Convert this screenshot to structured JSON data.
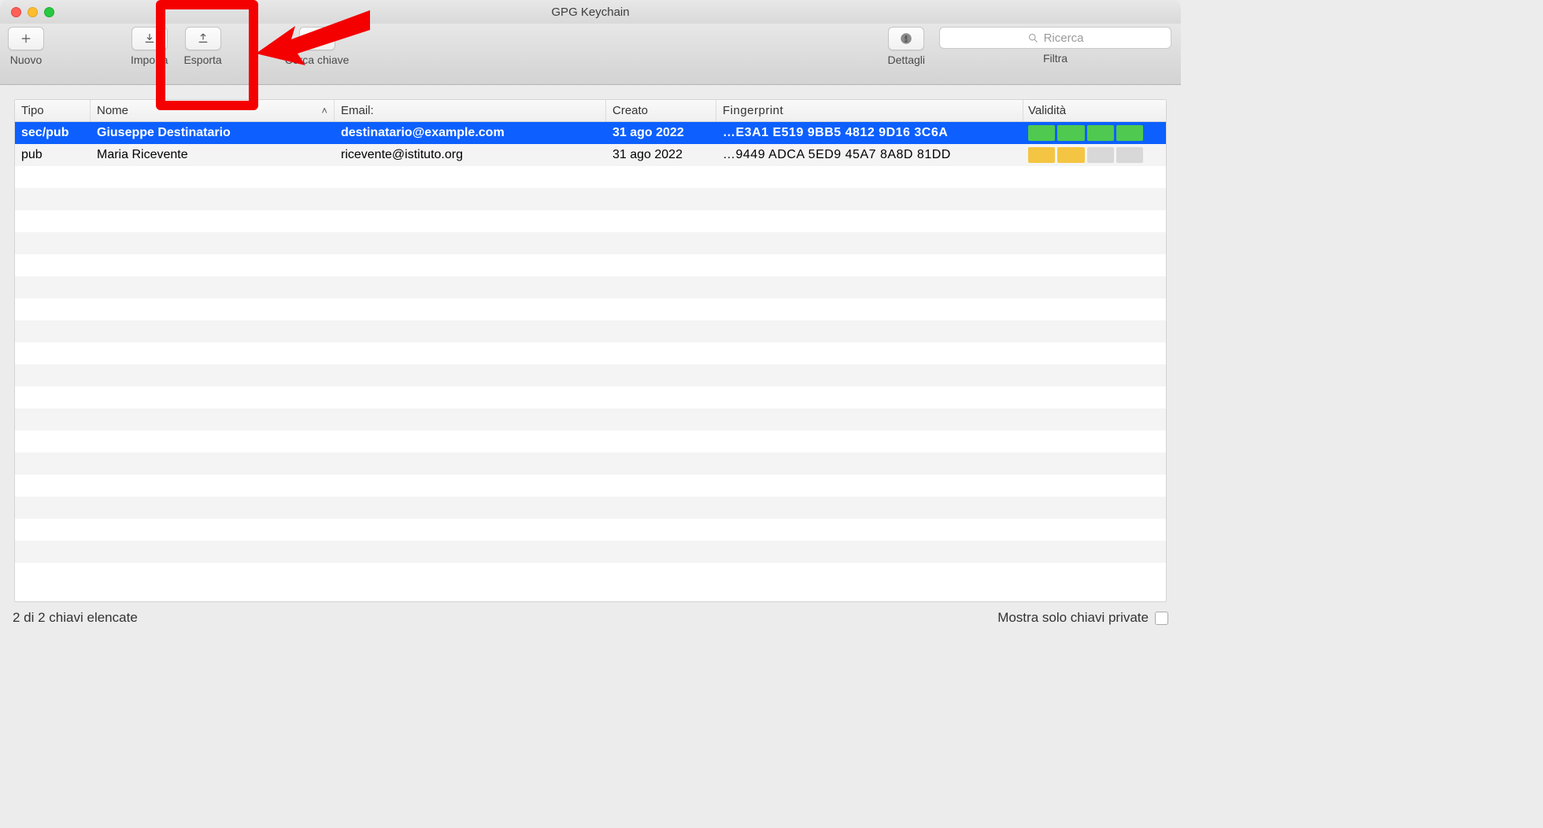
{
  "window": {
    "title": "GPG Keychain"
  },
  "toolbar": {
    "nuovo": "Nuovo",
    "importa": "Importa",
    "esporta": "Esporta",
    "cerca": "Cerca chiave",
    "dettagli": "Dettagli",
    "filtra": "Filtra",
    "search_placeholder": "Ricerca"
  },
  "columns": {
    "tipo": "Tipo",
    "nome": "Nome",
    "email": "Email:",
    "creato": "Creato",
    "fingerprint": "Fingerprint",
    "validita": "Validità"
  },
  "rows": [
    {
      "selected": true,
      "tipo": "sec/pub",
      "nome": "Giuseppe Destinatario",
      "email": "destinatario@example.com",
      "creato": "31 ago 2022",
      "fingerprint": "…E3A1   E519  9BB5  4812  9D16  3C6A",
      "validity": [
        "green",
        "green",
        "green",
        "green"
      ]
    },
    {
      "selected": false,
      "tipo": "pub",
      "nome": "Maria Ricevente",
      "email": "ricevente@istituto.org",
      "creato": "31 ago 2022",
      "fingerprint": "…9449   ADCA  5ED9  45A7  8A8D  81DD",
      "validity": [
        "yellow",
        "yellow",
        "grey",
        "grey"
      ]
    }
  ],
  "status": {
    "count_text": "2 di 2 chiavi elencate",
    "private_only": "Mostra solo chiavi private"
  }
}
